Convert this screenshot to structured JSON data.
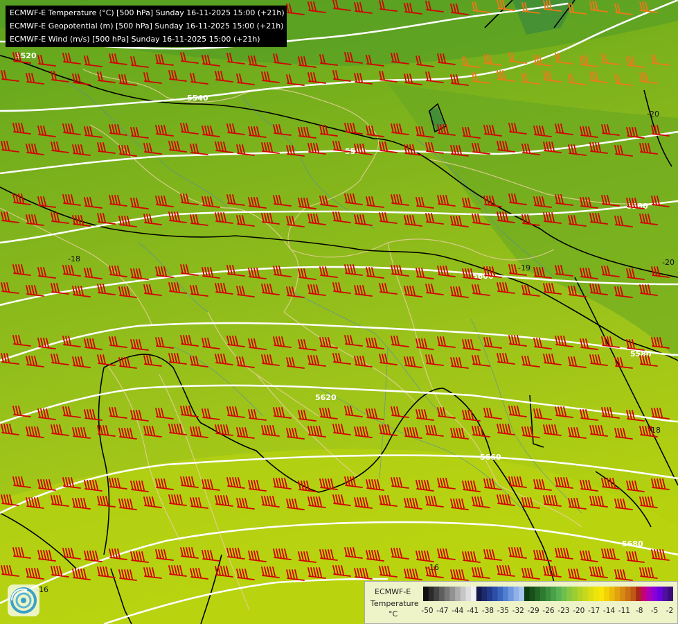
{
  "header": {
    "line1": "ECMWF-E Temperature (°C) [500 hPa] Sunday 16-11-2025 15:00 (+21h)",
    "line2": "ECMWF-E Geopotential (m) [500 hPa] Sunday 16-11-2025 15:00 (+21h)",
    "line3": "ECMWF-E Wind (m/s) [500 hPa] Sunday 16-11-2025 15:00 (+21h)"
  },
  "geopotential_labels": [
    "5520",
    "5540",
    "5560",
    "5580",
    "5600",
    "5580",
    "5620",
    "5660",
    "5680"
  ],
  "temperature_labels": [
    "-18",
    "-19",
    "-20",
    "-20",
    "-18",
    "-16",
    "-16"
  ],
  "legend": {
    "title1": "ECMWF-E",
    "title2": "Temperature",
    "unit": "°C",
    "ticks": [
      "-50",
      "-47",
      "-44",
      "-41",
      "-38",
      "-35",
      "-32",
      "-29",
      "-26",
      "-23",
      "-20",
      "-17",
      "-14",
      "-11",
      "-8",
      "-5",
      "-2"
    ],
    "colors": [
      "#111111",
      "#2b2b2b",
      "#444444",
      "#5e5e5e",
      "#787878",
      "#929292",
      "#acacac",
      "#c6c6c6",
      "#dedede",
      "#f2f2f2",
      "#131a4a",
      "#1c2a6e",
      "#233a8c",
      "#2c4ea8",
      "#3b66c0",
      "#527fd2",
      "#6f98de",
      "#8fb1e8",
      "#aac6ef",
      "#0e3d10",
      "#17501a",
      "#226524",
      "#2e7a30",
      "#3b8e3c",
      "#4aa248",
      "#59b355",
      "#6fbf4d",
      "#87c83f",
      "#9ccd32",
      "#b3d326",
      "#c8d91c",
      "#dbdf12",
      "#ece40a",
      "#f7e606",
      "#f3d106",
      "#ecbb0a",
      "#e1a20e",
      "#d68a12",
      "#cc7214",
      "#bf5716",
      "#a82716",
      "#c4007a",
      "#a800b8",
      "#8a00d6",
      "#6a00e0",
      "#50109e",
      "#3b0c7a"
    ]
  },
  "colors": {
    "barb": "#d40000",
    "barb_orange": "#f07818",
    "geopotential": "#ffffff",
    "isotherm": "#000000"
  }
}
